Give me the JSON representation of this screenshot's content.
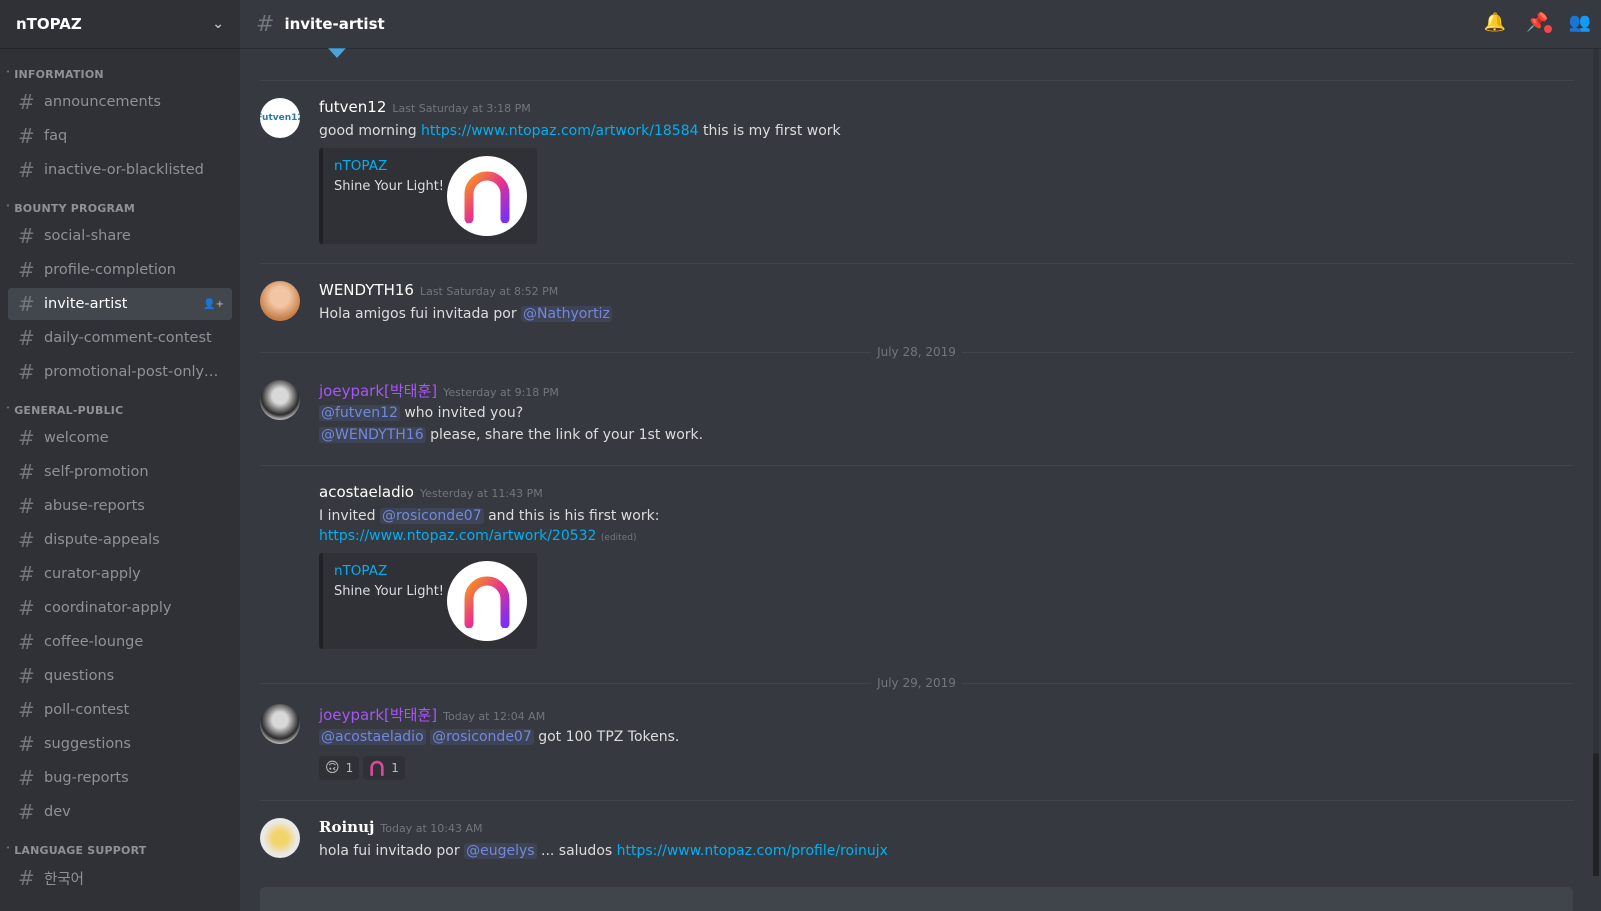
{
  "server": {
    "name": "nTOPAZ"
  },
  "channel": {
    "name": "invite-artist"
  },
  "sidebar": {
    "categories": [
      {
        "name": "INFORMATION",
        "channels": [
          "announcements",
          "faq",
          "inactive-or-blacklisted"
        ]
      },
      {
        "name": "BOUNTY PROGRAM",
        "channels": [
          "social-share",
          "profile-completion",
          "invite-artist",
          "daily-comment-contest",
          "promotional-post-only-f..."
        ]
      },
      {
        "name": "GENERAL-PUBLIC",
        "channels": [
          "welcome",
          "self-promotion",
          "abuse-reports",
          "dispute-appeals",
          "curator-apply",
          "coordinator-apply",
          "coffee-lounge",
          "questions",
          "poll-contest",
          "suggestions",
          "bug-reports",
          "dev"
        ]
      },
      {
        "name": "LANGUAGE SUPPORT",
        "channels": [
          "한국어"
        ]
      }
    ],
    "active_channel": "invite-artist"
  },
  "messages": {
    "m1": {
      "author": "futven12",
      "timestamp": "Last Saturday at 3:18 PM",
      "text_before": "good morning ",
      "link": "https://www.ntopaz.com/artwork/18584",
      "text_after": " this is my first work",
      "avatar_text": "Futven12"
    },
    "m1_embed": {
      "provider": "nTOPAZ",
      "description": "Shine Your Light!"
    },
    "m2": {
      "author": "WENDYTH16",
      "timestamp": "Last Saturday at 8:52 PM",
      "text_before": "Hola amigos fui invitada por ",
      "mention": "@Nathyortiz"
    },
    "date1": "July 28, 2019",
    "m3": {
      "author": "joeypark[박태훈]",
      "timestamp": "Yesterday at 9:18 PM",
      "mention1": "@futven12",
      "line1_rest": " who invited you?",
      "mention2": "@WENDYTH16",
      "line2_rest": " please, share the link of your 1st work."
    },
    "m4": {
      "author": "acostaeladio",
      "timestamp": "Yesterday at 11:43 PM",
      "text_before": "I invited ",
      "mention": "@rosiconde07",
      "text_after": " and this is his first work:",
      "link": "https://www.ntopaz.com/artwork/20532",
      "edited": "(edited)"
    },
    "m4_embed": {
      "provider": "nTOPAZ",
      "description": "Shine Your Light!"
    },
    "date2": "July 29, 2019",
    "m5": {
      "author": "joeypark[박태훈]",
      "timestamp": "Today at 12:04 AM",
      "mention1": "@acostaeladio",
      "mention2": "@rosiconde07",
      "text_after": " got 100 TPZ Tokens.",
      "reaction1_count": "1",
      "reaction2_count": "1"
    },
    "m6": {
      "author": "Roinuj",
      "timestamp": "Today at 10:43 AM",
      "text_before": "hola fui invitado por ",
      "mention": "@eugelys",
      "text_mid": " ... saludos ",
      "link": "https://www.ntopaz.com/profile/roinujx"
    }
  }
}
